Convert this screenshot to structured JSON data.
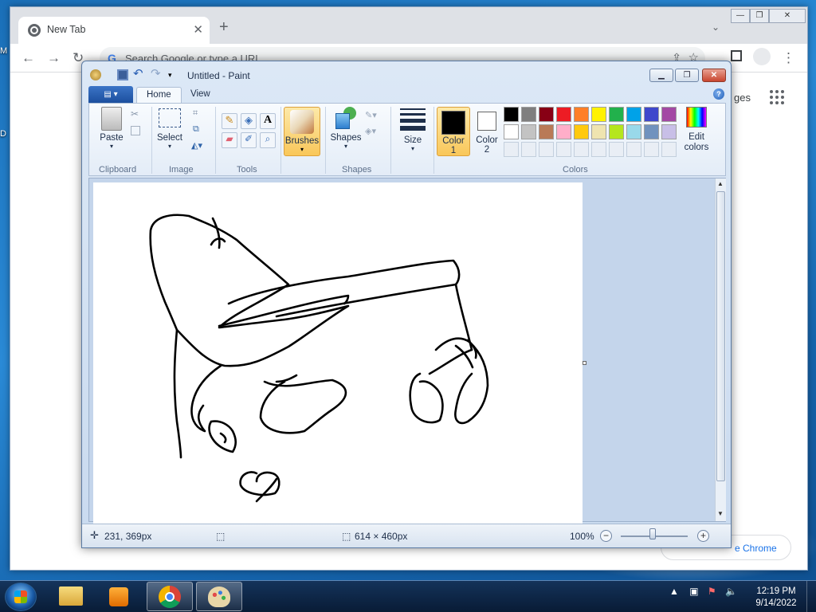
{
  "desktop": {
    "left_label_top": "M",
    "left_label_bottom": "D"
  },
  "chrome": {
    "tab_title": "New Tab",
    "tab_close": "✕",
    "new_tab": "+",
    "tab_search": "⌄",
    "omnibox_placeholder": "Search Google or type a URL",
    "ntp_link": "ges",
    "customize_label": "e Chrome",
    "window_controls": [
      "—",
      "❐",
      "✕"
    ]
  },
  "paint": {
    "title": "Untitled - Paint",
    "file_menu": "▤ ▾",
    "tabs": [
      "Home",
      "View"
    ],
    "groups": {
      "clipboard": "Clipboard",
      "image": "Image",
      "tools": "Tools",
      "shapes": "Shapes",
      "colors": "Colors"
    },
    "buttons": {
      "paste": "Paste",
      "select": "Select",
      "brushes": "Brushes",
      "shapes": "Shapes",
      "size": "Size",
      "color1": "Color",
      "color1_num": "1",
      "color2": "Color",
      "color2_num": "2",
      "edit_colors_line1": "Edit",
      "edit_colors_line2": "colors"
    },
    "color1": "#000000",
    "color2": "#ffffff",
    "palette_row1": [
      "#000000",
      "#7f7f7f",
      "#880015",
      "#ed1c24",
      "#ff7f27",
      "#fff200",
      "#22b14c",
      "#00a2e8",
      "#3f48cc",
      "#a349a4"
    ],
    "palette_row2": [
      "#ffffff",
      "#c3c3c3",
      "#b97a57",
      "#ffaec9",
      "#ffc90e",
      "#efe4b0",
      "#b5e61d",
      "#99d9ea",
      "#7092be",
      "#c8bfe7"
    ],
    "status": {
      "cursor_pos": "231, 369px",
      "canvas_size": "614 × 460px",
      "zoom": "100%"
    }
  },
  "taskbar": {
    "clock_time": "12:19 PM",
    "clock_date": "9/14/2022"
  },
  "colors": {
    "chrome_bar": "#dee1e6",
    "paint_ribbon": "#e3ecf7",
    "brush_active": "#f9c75a"
  }
}
